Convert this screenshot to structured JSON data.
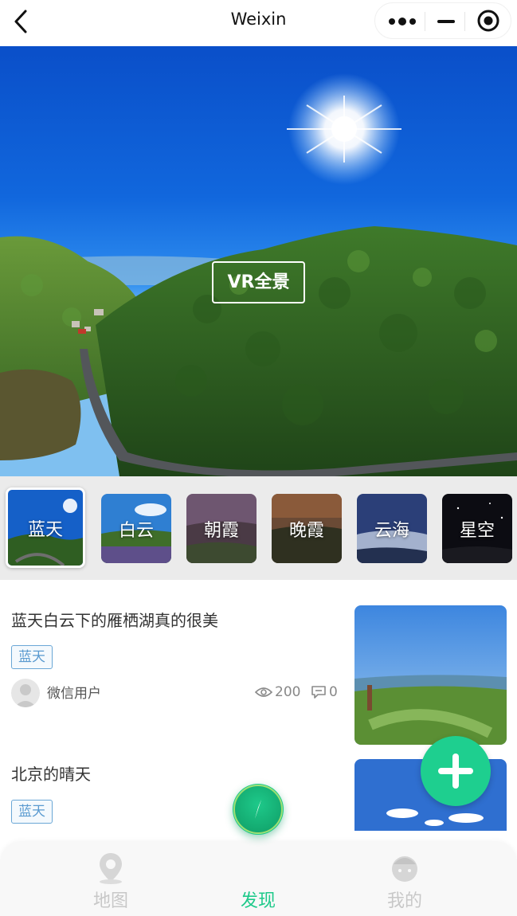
{
  "navbar": {
    "title": "Weixin",
    "back_icon": "chevron-left-icon",
    "more_icon": "more-dots-icon",
    "minimize_icon": "minimize-icon",
    "close_icon": "target-circle-icon"
  },
  "hero": {
    "badge": "VR全景"
  },
  "categories": [
    {
      "label": "蓝天",
      "active": true
    },
    {
      "label": "白云",
      "active": false
    },
    {
      "label": "朝霞",
      "active": false
    },
    {
      "label": "晚霞",
      "active": false
    },
    {
      "label": "云海",
      "active": false
    },
    {
      "label": "星空",
      "active": false
    }
  ],
  "posts": [
    {
      "title": "蓝天白云下的雁栖湖真的很美",
      "tag": "蓝天",
      "author": "微信用户",
      "views": "200",
      "comments": "0"
    },
    {
      "title": "北京的晴天",
      "tag": "蓝天"
    }
  ],
  "fab": {
    "icon": "plus-icon"
  },
  "tabbar": {
    "items": [
      {
        "label": "地图",
        "icon": "map-pin-icon",
        "active": false
      },
      {
        "label": "发现",
        "icon": "compass-icon",
        "active": true
      },
      {
        "label": "我的",
        "icon": "user-icon",
        "active": false
      }
    ]
  },
  "colors": {
    "accent": "#1ec98a",
    "tag_border": "#6aa7d6",
    "tag_text": "#5a9ad0",
    "category_strip": "#ebebeb"
  }
}
